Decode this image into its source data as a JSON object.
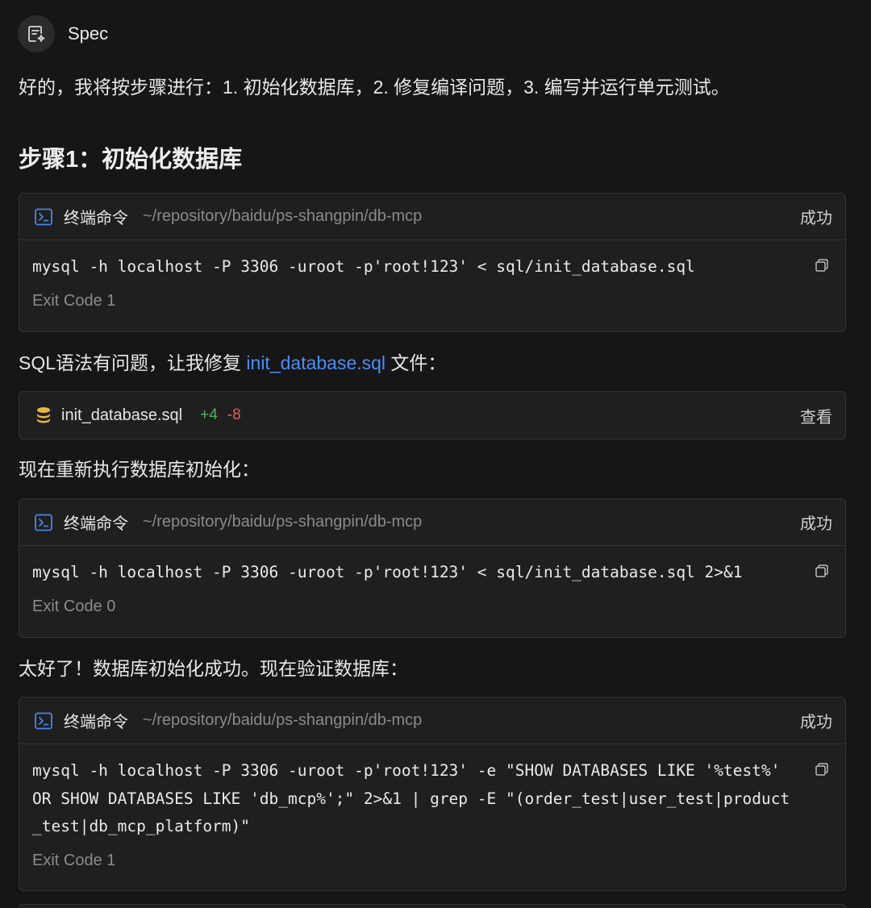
{
  "agent": {
    "name": "Spec",
    "icon": "spec-document-icon"
  },
  "intro": "好的，我将按步骤进行：1. 初始化数据库，2. 修复编译问题，3. 编写并运行单元测试。",
  "step1_heading": "步骤1：初始化数据库",
  "commands": [
    {
      "title": "终端命令",
      "path": "~/repository/baidu/ps-shangpin/db-mcp",
      "status": "成功",
      "command": "mysql -h localhost -P 3306 -uroot -p'root!123' < sql/init_database.sql",
      "exit": "Exit Code 1"
    },
    {
      "title": "终端命令",
      "path": "~/repository/baidu/ps-shangpin/db-mcp",
      "status": "成功",
      "command": "mysql -h localhost -P 3306 -uroot -p'root!123' < sql/init_database.sql 2>&1",
      "exit": "Exit Code 0"
    },
    {
      "title": "终端命令",
      "path": "~/repository/baidu/ps-shangpin/db-mcp",
      "status": "成功",
      "command": "mysql -h localhost -P 3306 -uroot -p'root!123' -e \"SHOW DATABASES LIKE '%test%' OR SHOW DATABASES LIKE 'db_mcp%';\" 2>&1 | grep -E \"(order_test|user_test|product_test|db_mcp_platform)\"",
      "exit": "Exit Code 1"
    }
  ],
  "sql_fix": {
    "prefix": "SQL语法有问题，让我修复 ",
    "link": "init_database.sql",
    "suffix": " 文件："
  },
  "file_change": {
    "name": "init_database.sql",
    "additions": "+4",
    "deletions": "-8",
    "view_label": "查看"
  },
  "rerun_text": "现在重新执行数据库初始化：",
  "verify_text": "太好了！数据库初始化成功。现在验证数据库：",
  "colors": {
    "background": "#161616",
    "card": "#1f1f1f",
    "link": "#4c8df6",
    "terminal_icon": "#4a86e8",
    "additions": "#57b05a",
    "deletions": "#e0605a",
    "db_icon": "#e8b93a"
  }
}
